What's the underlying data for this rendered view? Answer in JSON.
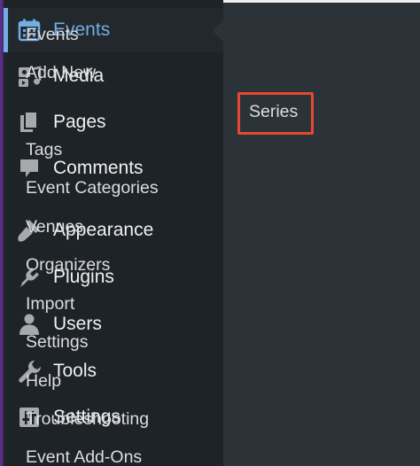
{
  "sidebar": {
    "items": [
      {
        "label": "Events",
        "icon": "calendar-icon",
        "current": true
      },
      {
        "label": "Media",
        "icon": "media-icon"
      },
      {
        "label": "Pages",
        "icon": "pages-icon"
      },
      {
        "label": "Comments",
        "icon": "comments-icon"
      },
      {
        "label": "Appearance",
        "icon": "appearance-brush-icon"
      },
      {
        "label": "Plugins",
        "icon": "plugin-plug-icon"
      },
      {
        "label": "Users",
        "icon": "user-icon"
      },
      {
        "label": "Tools",
        "icon": "wrench-icon"
      },
      {
        "label": "Settings",
        "icon": "settings-sliders-icon"
      }
    ]
  },
  "submenu": {
    "items": [
      {
        "label": "Events"
      },
      {
        "label": "Add New"
      },
      {
        "label": "Series",
        "highlighted": true
      },
      {
        "label": "Tags"
      },
      {
        "label": "Event Categories"
      },
      {
        "label": "Venues"
      },
      {
        "label": "Organizers"
      },
      {
        "label": "Import"
      },
      {
        "label": "Settings"
      },
      {
        "label": "Help"
      },
      {
        "label": "Troubleshooting"
      },
      {
        "label": "Event Add-Ons"
      }
    ]
  },
  "colors": {
    "sidebar_bg": "#1d2327",
    "submenu_bg": "#2c3338",
    "accent": "#72aee6",
    "highlight_border": "#e34a2f",
    "text": "#f0f0f1",
    "icon": "#a7aaad"
  }
}
